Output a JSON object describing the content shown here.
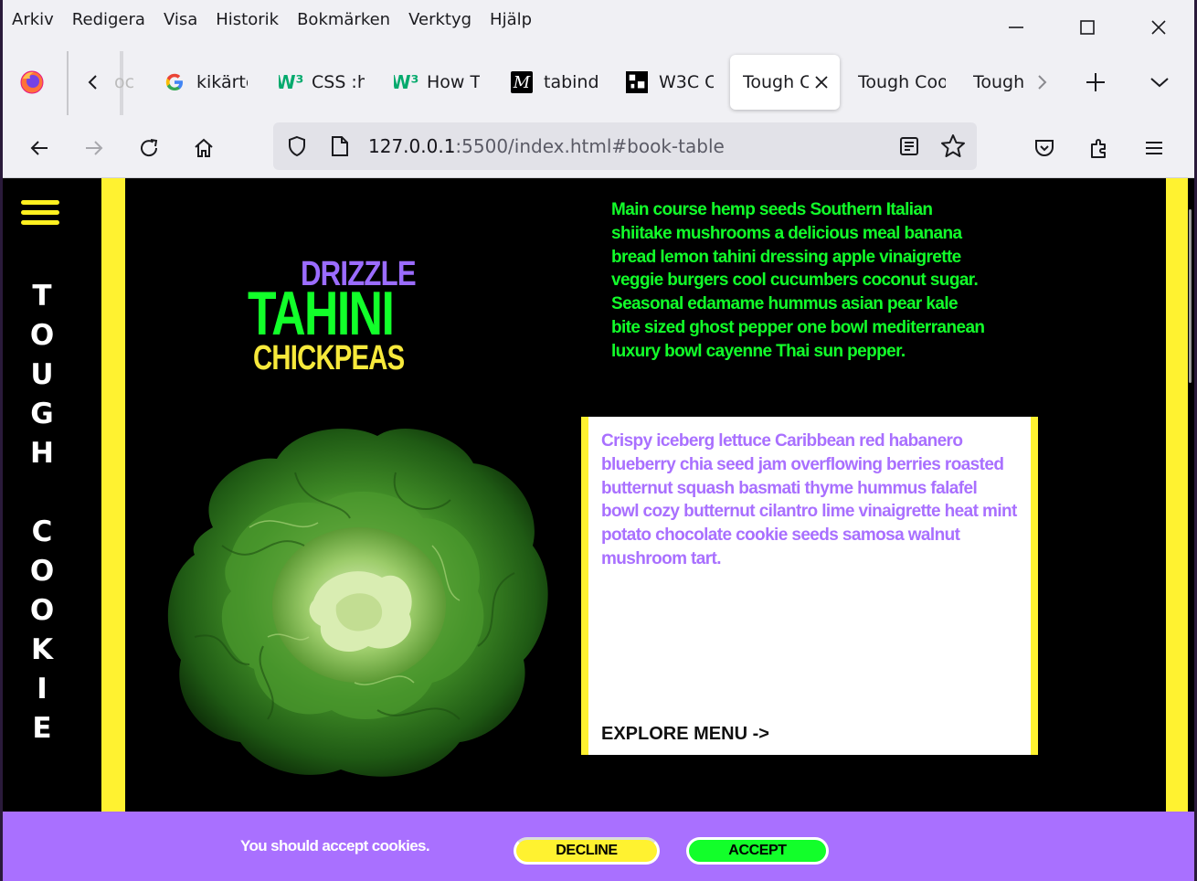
{
  "menubar": {
    "items": [
      "Arkiv",
      "Redigera",
      "Visa",
      "Historik",
      "Bokmärken",
      "Verktyg",
      "Hjälp"
    ]
  },
  "tabs": [
    {
      "label": "oc",
      "icon": "overflow-tab"
    },
    {
      "label": "kikärto",
      "icon": "google-icon"
    },
    {
      "label": "CSS :h",
      "icon": "w3schools-icon"
    },
    {
      "label": "How T",
      "icon": "w3schools-icon"
    },
    {
      "label": "tabind",
      "icon": "mdn-icon"
    },
    {
      "label": "W3C C",
      "icon": "w3c-icon"
    },
    {
      "label": "Tough C",
      "icon": "none",
      "active": true
    },
    {
      "label": "Tough Coo",
      "icon": "none"
    },
    {
      "label": "Tough",
      "icon": "none"
    }
  ],
  "url": {
    "host": "127.0.0.1",
    "rest": ":5500/index.html#book-table"
  },
  "page": {
    "brand": "TOUGH COOKIE",
    "title_drizzle": "DRIZZLE",
    "title_tahini": "TAHINI",
    "title_chickpeas": "CHICKPEAS",
    "intro": "Main course hemp seeds Southern Italian shiitake mushrooms a delicious meal banana bread lemon tahini dressing apple vinaigrette veggie burgers cool cucumbers coconut sugar. Seasonal edamame hummus asian pear kale bite sized ghost pepper one bowl mediterranean luxury bowl cayenne Thai sun pepper.",
    "card_text": "Crispy iceberg lettuce Caribbean red habanero blueberry chia seed jam overflowing berries roasted butternut squash basmati thyme hummus falafel bowl cozy butternut cilantro lime vinaigrette heat mint potato chocolate cookie seeds samosa walnut mushroom tart.",
    "explore": "EXPLORE MENU ->"
  },
  "cookie": {
    "message": "You should accept cookies.",
    "decline": "DECLINE",
    "accept": "ACCEPT"
  },
  "colors": {
    "yellow": "#fff230",
    "green": "#12ff2a",
    "purple": "#a970ff"
  }
}
